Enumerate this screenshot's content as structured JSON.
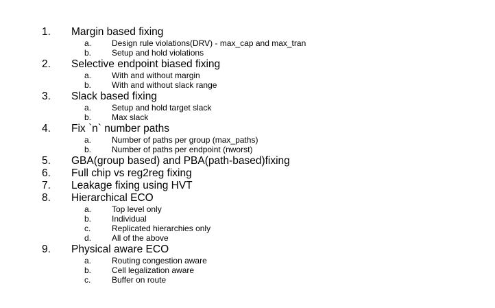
{
  "items": [
    {
      "number": "1.",
      "label": "Margin based fixing",
      "subitems": [
        {
          "letter": "a.",
          "label": "Design rule violations(DRV) - max_cap and max_tran"
        },
        {
          "letter": "b.",
          "label": "Setup and hold violations"
        }
      ]
    },
    {
      "number": "2.",
      "label": "Selective endpoint biased fixing",
      "subitems": [
        {
          "letter": "a.",
          "label": "With and without margin"
        },
        {
          "letter": "b.",
          "label": "With and without slack range"
        }
      ]
    },
    {
      "number": "3.",
      "label": "Slack based fixing",
      "subitems": [
        {
          "letter": "a.",
          "label": "Setup and hold target slack"
        },
        {
          "letter": "b.",
          "label": "Max slack"
        }
      ]
    },
    {
      "number": "4.",
      "label": "Fix `n` number paths",
      "subitems": [
        {
          "letter": "a.",
          "label": "Number of paths per group (max_paths)"
        },
        {
          "letter": "b.",
          "label": "Number of paths per endpoint (nworst)"
        }
      ]
    },
    {
      "number": "5.",
      "label": "GBA(group based) and PBA(path-based)fixing",
      "subitems": []
    },
    {
      "number": "6.",
      "label": "Full chip vs reg2reg fixing",
      "subitems": []
    },
    {
      "number": "7.",
      "label": "Leakage fixing using HVT",
      "subitems": []
    },
    {
      "number": "8.",
      "label": "Hierarchical ECO",
      "subitems": [
        {
          "letter": "a.",
          "label": "Top level only"
        },
        {
          "letter": "b.",
          "label": "Individual"
        },
        {
          "letter": "c.",
          "label": "Replicated hierarchies only"
        },
        {
          "letter": "d.",
          "label": "All of the above"
        }
      ]
    },
    {
      "number": "9.",
      "label": "Physical aware ECO",
      "subitems": [
        {
          "letter": "a.",
          "label": "Routing congestion aware"
        },
        {
          "letter": "b.",
          "label": "Cell legalization aware"
        },
        {
          "letter": "c.",
          "label": "Buffer on route"
        }
      ]
    }
  ]
}
